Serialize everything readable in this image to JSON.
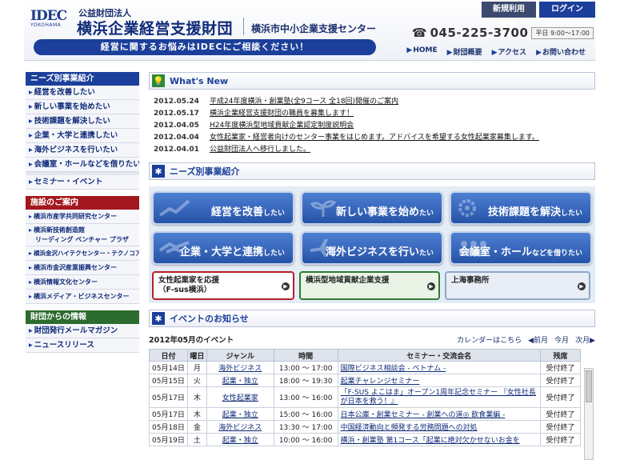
{
  "header": {
    "logo_mark": "IDEC",
    "logo_sub": "YOKOHAMA",
    "org_type": "公益財団法人",
    "org_name": "横浜企業経営支援財団",
    "org_center": "横浜市中小企業支援センター",
    "tagline": "経営に関するお悩みはIDECにご相談ください！",
    "register_label": "新規利用登録",
    "login_label": "ログイン",
    "phone": "045-225-3700",
    "hours": "平日 9:00～17:00",
    "util_nav": [
      "HOME",
      "財団概要",
      "アクセス",
      "お問い合わせ"
    ]
  },
  "sidebar": {
    "needs_head": "ニーズ別事業紹介",
    "needs_items": [
      "経営を改善したい",
      "新しい事業を始めたい",
      "技術課題を解決したい",
      "企業・大学と連携したい",
      "海外ビジネスを行いたい",
      "会議室・ホールなどを借りたい"
    ],
    "seminar_item": "セミナー・イベント",
    "facilities_head": "施設のご案内",
    "facilities_items": [
      "横浜市産学共同研究センター",
      "横浜新技術創造館",
      "リーディング ベンチャー プラザ",
      "横浜金沢ハイテクセンター・テクノコア",
      "横浜市金沢産業振興センター",
      "横浜情報文化センター",
      "横浜メディア・ビジネスセンター"
    ],
    "info_head": "財団からの情報",
    "info_items": [
      "財団発行メールマガジン",
      "ニュースリリース"
    ]
  },
  "whats_new": {
    "title": "What's New",
    "items": [
      {
        "date": "2012.05.24",
        "title": "平成24年度横浜・創業塾(全9コース 全18回)開催のご案内"
      },
      {
        "date": "2012.05.17",
        "title": "横浜企業経営支援財団の職員を募集します！"
      },
      {
        "date": "2012.04.05",
        "title": "H24年度横浜型地域貢献企業認定制度説明会"
      },
      {
        "date": "2012.04.04",
        "title": "女性起業家・経営者向けのセンター事業をはじめます。アドバイスを希望する女性起業家募集します。"
      },
      {
        "date": "2012.04.01",
        "title": "公益財団法人へ移行しました。"
      }
    ]
  },
  "needs": {
    "title": "ニーズ別事業紹介",
    "buttons": [
      {
        "main": "経営を改善",
        "sub": "したい"
      },
      {
        "main": "新しい事業を始め",
        "sub": "たい"
      },
      {
        "main": "技術課題を解決",
        "sub": "したい"
      },
      {
        "main": "企業・大学と連携",
        "sub": "したい"
      },
      {
        "main": "海外ビジネスを行い",
        "sub": "たい"
      },
      {
        "main": "会議室・ホール",
        "sub": "などを借りたい"
      }
    ],
    "sub_buttons": [
      {
        "line1": "女性起業家を応援",
        "line2": "（F-sus横浜）"
      },
      {
        "line1": "横浜型地域貢献企業支援",
        "line2": ""
      },
      {
        "line1": "上海事務所",
        "line2": ""
      }
    ]
  },
  "events": {
    "title": "イベントのお知らせ",
    "month_label": "2012年05月のイベント",
    "calendar_label": "カレンダーはこちら",
    "prev": "前月",
    "this": "今月",
    "next": "次月",
    "columns": [
      "日付",
      "曜日",
      "ジャンル",
      "時間",
      "セミナー・交流会名",
      "残席"
    ],
    "rows": [
      {
        "date": "05月14日",
        "dow": "月",
        "genre": "海外ビジネス",
        "time": "13:00 ～ 17:00",
        "title": "国際ビジネス相談会 - ベトナム -",
        "seats": "受付終了"
      },
      {
        "date": "05月15日",
        "dow": "火",
        "genre": "起業・独立",
        "time": "18:00 ～ 19:30",
        "title": "起業チャレンジセミナー",
        "seats": "受付終了"
      },
      {
        "date": "05月17日",
        "dow": "木",
        "genre": "女性起業家",
        "time": "13:00 ～ 16:00",
        "title": "「F-SUS よこはま」オープン1周年記念セミナー 『女性社長が日本を救う！』",
        "seats": "受付終了"
      },
      {
        "date": "05月17日",
        "dow": "木",
        "genre": "起業・独立",
        "time": "15:00 ～ 16:00",
        "title": "日本公庫・創業セミナー - 創業への道◎ 飲食業編 -",
        "seats": "受付終了"
      },
      {
        "date": "05月18日",
        "dow": "金",
        "genre": "海外ビジネス",
        "time": "13:30 ～ 17:00",
        "title": "中国経済動向と頻発する労務問題への対処",
        "seats": "受付終了"
      },
      {
        "date": "05月19日",
        "dow": "土",
        "genre": "起業・独立",
        "time": "10:00 ～ 16:00",
        "title": "横浜・創業塾 第1コース「起業に絶対欠かせないお金を",
        "seats": "受付終了"
      }
    ]
  }
}
